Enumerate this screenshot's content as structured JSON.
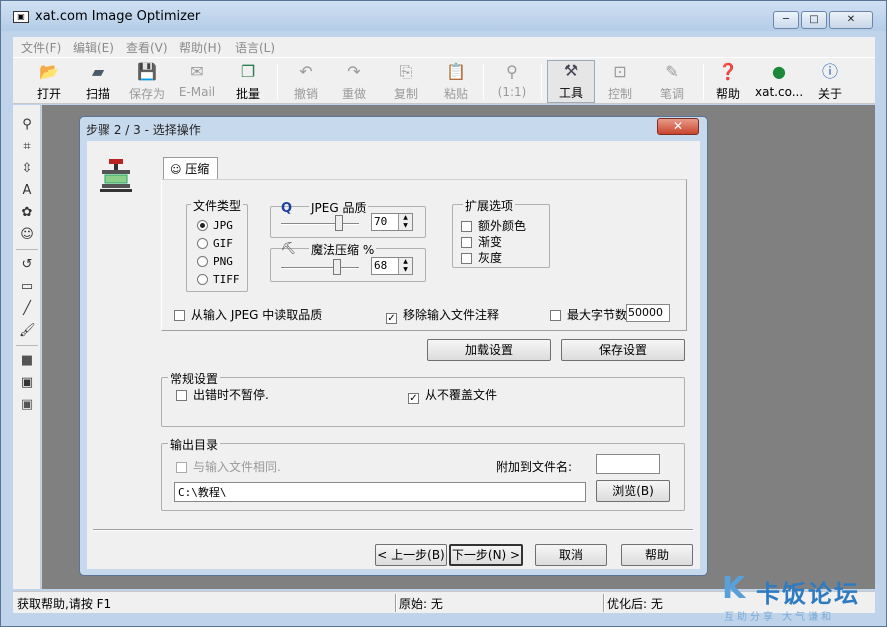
{
  "window": {
    "title": "xat.com  Image Optimizer",
    "controls": {
      "minimize": "─",
      "maximize": "□",
      "close": "✕"
    }
  },
  "menu": [
    "文件(F)",
    "编辑(E)",
    "查看(V)",
    "帮助(H)",
    "语言(L)"
  ],
  "toolbar": {
    "open": "打开",
    "scan": "扫描",
    "save_as": "保存为",
    "email": "E-Mail",
    "batch": "批量",
    "undo": "撤销",
    "redo": "重做",
    "copy": "复制",
    "paste": "粘贴",
    "zoom": "(1:1)",
    "tools": "工具",
    "control": "控制",
    "brush": "笔调",
    "help": "帮助",
    "site": "xat.co...",
    "about": "关于"
  },
  "dialog": {
    "title": "步骤 2 / 3 - 选择操作",
    "close": "✕",
    "tab_label": "压缩",
    "file_type": {
      "title": "文件类型",
      "options": [
        "JPG",
        "GIF",
        "PNG",
        "TIFF"
      ],
      "selected": "JPG"
    },
    "jpeg_quality": {
      "icon_text": "Q",
      "title": "JPEG 品质",
      "value": "70"
    },
    "magic_compress": {
      "title": "魔法压缩 %",
      "value": "68"
    },
    "extended": {
      "title": "扩展选项",
      "options": [
        "额外颜色",
        "渐变",
        "灰度"
      ]
    },
    "read_quality": {
      "label": "从输入 JPEG 中读取品质",
      "checked": false
    },
    "remove_comments": {
      "label": "移除输入文件注释",
      "checked": true
    },
    "max_bytes": {
      "label": "最大字节数",
      "checked": false,
      "value": "50000"
    },
    "load_settings": "加载设置",
    "save_settings": "保存设置",
    "general": {
      "title": "常规设置",
      "no_pause": {
        "label": "出错时不暂停.",
        "checked": false
      },
      "no_overwrite": {
        "label": "从不覆盖文件",
        "checked": true
      }
    },
    "output": {
      "title": "输出目录",
      "same_as_input": {
        "label": "与输入文件相同.",
        "checked": false
      },
      "suffix_label": "附加到文件名:",
      "suffix_value": "",
      "path": "C:\\教程\\",
      "browse": "浏览(B)"
    },
    "back": "< 上一步(B)",
    "next": "下一步(N) >",
    "cancel": "取消",
    "help": "帮助"
  },
  "status": {
    "hint": "获取帮助,请按 F1",
    "original": "原始: 无",
    "optimized": "优化后: 无"
  },
  "watermark": {
    "name": "卡饭论坛",
    "slogan": "互助分享  大气谦和"
  }
}
